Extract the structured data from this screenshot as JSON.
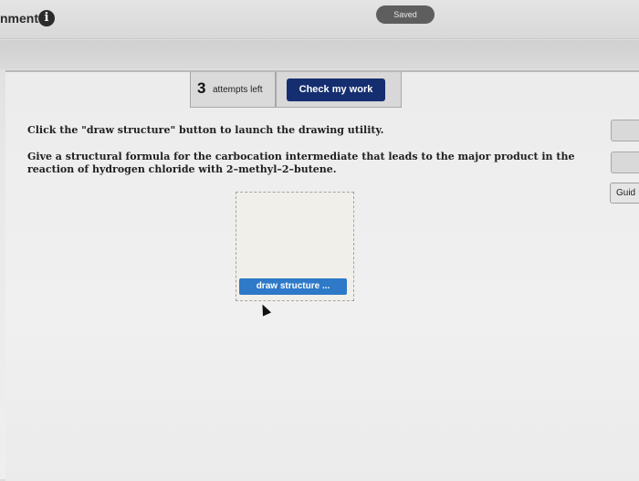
{
  "header": {
    "title": "nment",
    "info_icon": "i",
    "saved_label": "Saved"
  },
  "toolbar": {
    "attempts_count": "3",
    "attempts_label": "attempts left",
    "check_label": "Check my work"
  },
  "question": {
    "instruction": "Click the \"draw structure\" button to launch the drawing utility.",
    "prompt": "Give a structural formula for the carbocation intermediate that leads to the major product in the reaction of hydrogen chloride with 2–methyl–2–butene."
  },
  "drawing": {
    "button_label": "draw structure ..."
  },
  "sidebar": {
    "guide_label": "Guid"
  },
  "colors": {
    "check_button": "#152e70",
    "draw_button": "#2e79c8",
    "saved_badge": "#5e5e5e"
  }
}
